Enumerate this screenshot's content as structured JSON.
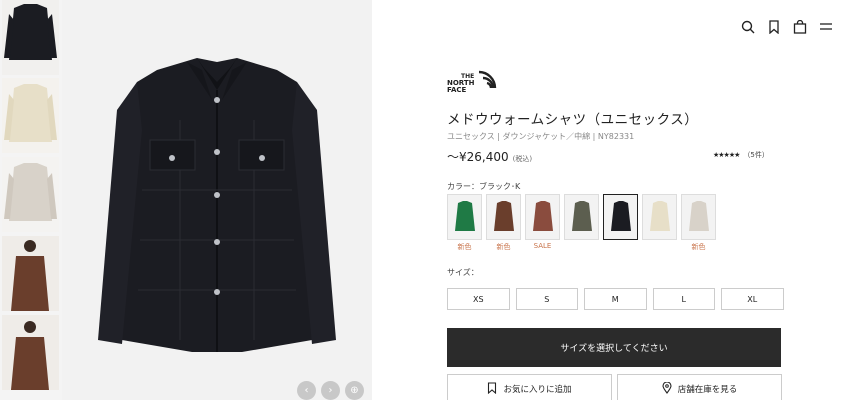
{
  "brand": {
    "logo_line1": "THE",
    "logo_line2": "NORTH",
    "logo_line3": "FACE"
  },
  "product": {
    "title": "メドウウォームシャツ（ユニセックス）",
    "subtitle": "ユニセックス | ダウンジャケット／中綿 | NY82331",
    "price": "～¥26,400",
    "tax_note": "(税込)",
    "rating_stars": "★★★★★",
    "review_count": "（5件）"
  },
  "color": {
    "label": "カラー：ブラック･K",
    "swatches": [
      {
        "name": "green",
        "hex": "#1f7a45",
        "tag": "新色"
      },
      {
        "name": "brown",
        "hex": "#6a3e2c",
        "tag": "新色"
      },
      {
        "name": "rust",
        "hex": "#8a4c3e",
        "tag": "SALE"
      },
      {
        "name": "olive",
        "hex": "#5c5e4f",
        "tag": ""
      },
      {
        "name": "black",
        "hex": "#1b1c22",
        "tag": "",
        "selected": true
      },
      {
        "name": "cream",
        "hex": "#e7dfc8",
        "tag": ""
      },
      {
        "name": "beige",
        "hex": "#d8d2c9",
        "tag": "新色"
      }
    ]
  },
  "size": {
    "label": "サイズ：",
    "options": [
      "XS",
      "S",
      "M",
      "L",
      "XL"
    ]
  },
  "actions": {
    "select_size": "サイズを選択してください",
    "favorite": "お気に入りに追加",
    "store_stock": "店舗在庫を見る"
  },
  "thumbnails": [
    {
      "name": "black-shirt",
      "hex": "#1b1c22"
    },
    {
      "name": "cream-shirt",
      "hex": "#e7dfc8"
    },
    {
      "name": "beige-shirt",
      "hex": "#d8d2c9"
    },
    {
      "name": "model-brown",
      "hex": "#6a3e2c"
    },
    {
      "name": "model-brown-2",
      "hex": "#6a3e2c"
    }
  ],
  "icons": [
    "search-icon",
    "bookmark-icon",
    "bag-icon",
    "menu-icon"
  ]
}
